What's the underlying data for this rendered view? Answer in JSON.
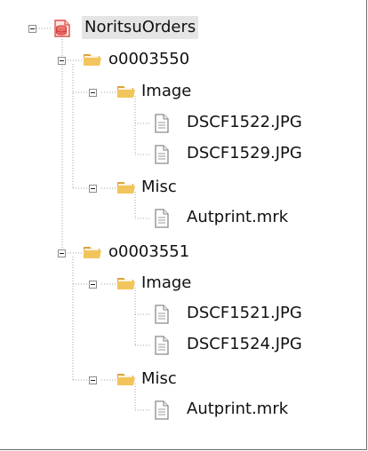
{
  "tree": {
    "root": {
      "label": "NoritsuOrders",
      "icon": "database-icon",
      "expanded": true,
      "selected": true
    },
    "orders": [
      {
        "label": "o0003550",
        "icon": "folder-icon",
        "expanded": true,
        "folders": [
          {
            "label": "Image",
            "icon": "folder-icon",
            "expanded": true,
            "files": [
              {
                "label": "DSCF1522.JPG",
                "icon": "file-icon"
              },
              {
                "label": "DSCF1529.JPG",
                "icon": "file-icon"
              }
            ]
          },
          {
            "label": "Misc",
            "icon": "folder-icon",
            "expanded": true,
            "files": [
              {
                "label": "Autprint.mrk",
                "icon": "file-icon"
              }
            ]
          }
        ]
      },
      {
        "label": "o0003551",
        "icon": "folder-icon",
        "expanded": true,
        "folders": [
          {
            "label": "Image",
            "icon": "folder-icon",
            "expanded": true,
            "files": [
              {
                "label": "DSCF1521.JPG",
                "icon": "file-icon"
              },
              {
                "label": "DSCF1524.JPG",
                "icon": "file-icon"
              }
            ]
          },
          {
            "label": "Misc",
            "icon": "folder-icon",
            "expanded": true,
            "files": [
              {
                "label": "Autprint.mrk",
                "icon": "file-icon"
              }
            ]
          }
        ]
      }
    ]
  },
  "colors": {
    "connector": "#a0a0a0",
    "folder": "#f2c55c",
    "folder_dark": "#d9a43a",
    "database": "#d9534f",
    "selection": "#e5e5e5"
  }
}
